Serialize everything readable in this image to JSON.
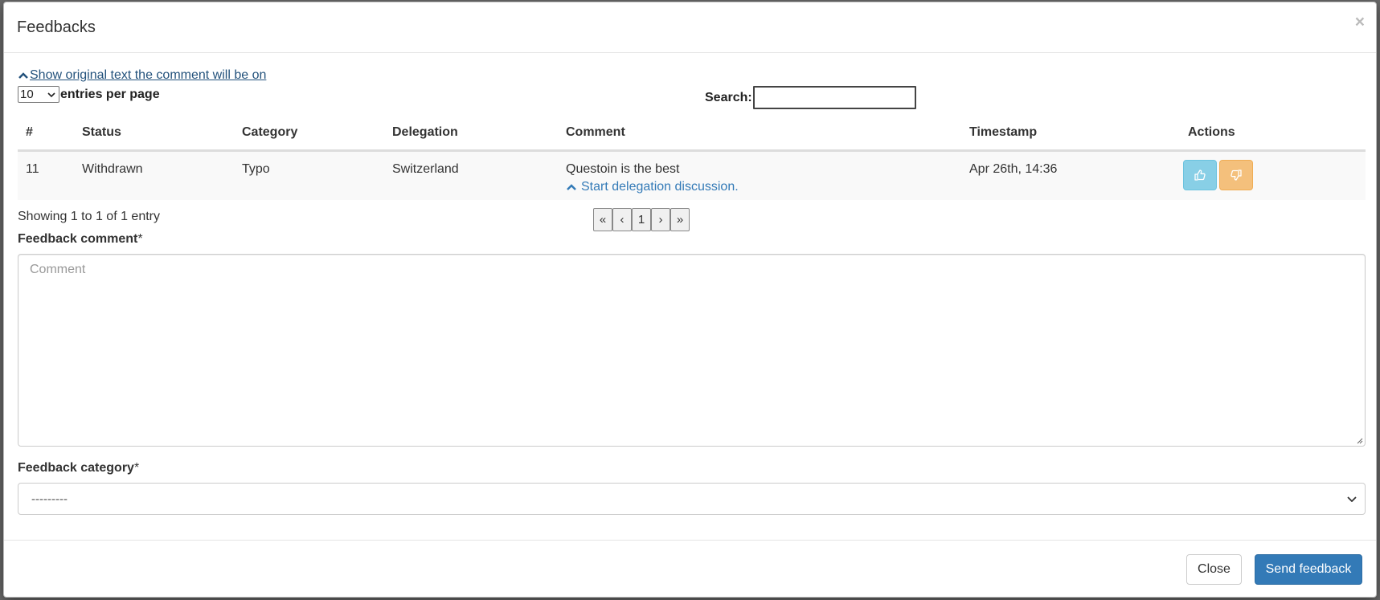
{
  "modal": {
    "title": "Feedbacks",
    "close_glyph": "×"
  },
  "toolbar": {
    "toggle_link": "Show original text the comment will be on",
    "length_value": "10",
    "length_suffix": "entries per page",
    "search_label": "Search:",
    "search_value": ""
  },
  "table": {
    "columns": [
      "#",
      "Status",
      "Category",
      "Delegation",
      "Comment",
      "Timestamp",
      "Actions"
    ],
    "rows": [
      {
        "id": "11",
        "status": "Withdrawn",
        "category": "Typo",
        "delegation": "Switzerland",
        "comment": "Questoin is the best",
        "discussion_link": "Start delegation discussion.",
        "timestamp": "Apr 26th, 14:36"
      }
    ]
  },
  "pagination": {
    "info": "Showing 1 to 1 of 1 entry",
    "first": "«",
    "prev": "‹",
    "current": "1",
    "next": "›",
    "last": "»"
  },
  "form": {
    "comment_label": "Feedback comment",
    "comment_placeholder": "Comment",
    "category_label": "Feedback category",
    "category_value": "---------",
    "required_mark": "*"
  },
  "footer": {
    "close_label": "Close",
    "send_label": "Send feedback"
  },
  "colors": {
    "link": "#337ab7",
    "primary": "#337ab7",
    "info_button": "#88cfe6",
    "warning_button": "#f4c07c"
  },
  "icons": {
    "like": "thumbs-up-icon",
    "dislike": "thumbs-down-icon",
    "chevron": "chevron-up-icon"
  }
}
